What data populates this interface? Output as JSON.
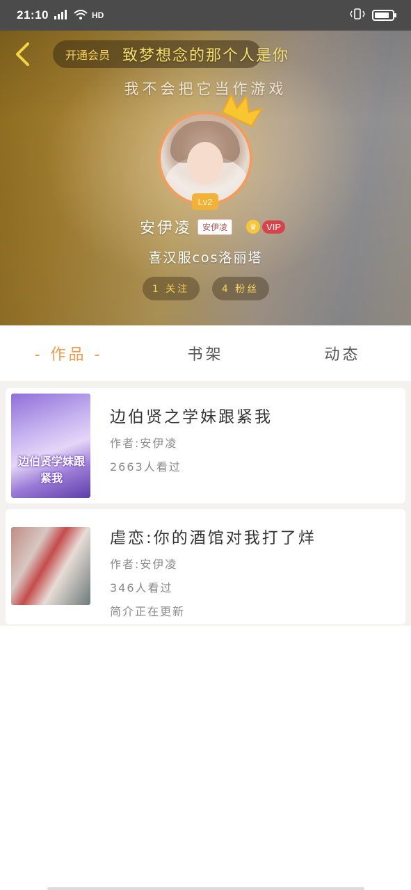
{
  "status_bar": {
    "time": "21:10",
    "network": "4G",
    "hd": "HD"
  },
  "header": {
    "vip_banner": "开通会员",
    "banner_title": "致梦想念的那个人是你",
    "signature": "我不会把它当作游戏",
    "level": "Lv2",
    "username": "安伊凌",
    "name_sticker": "安伊凌",
    "vip_label": "VIP",
    "bio": "喜汉服cos洛丽塔",
    "following": "1 关注",
    "followers": "4 粉丝",
    "colors": {
      "accent": "#ef9a4e",
      "gold": "#f4d15a"
    }
  },
  "tabs": [
    {
      "label": "- 作品 -",
      "active": true
    },
    {
      "label": "书架",
      "active": false
    },
    {
      "label": "动态",
      "active": false
    }
  ],
  "books": [
    {
      "title": "边伯贤之学妹跟紧我",
      "cover_text": "边伯贤学妹跟紧我",
      "author": "作者:安伊凌",
      "views": "2663人看过",
      "extra": ""
    },
    {
      "title": "虐恋:你的酒馆对我打了烊",
      "cover_text": "",
      "author": "作者:安伊凌",
      "views": "346人看过",
      "extra": "简介正在更新"
    }
  ]
}
